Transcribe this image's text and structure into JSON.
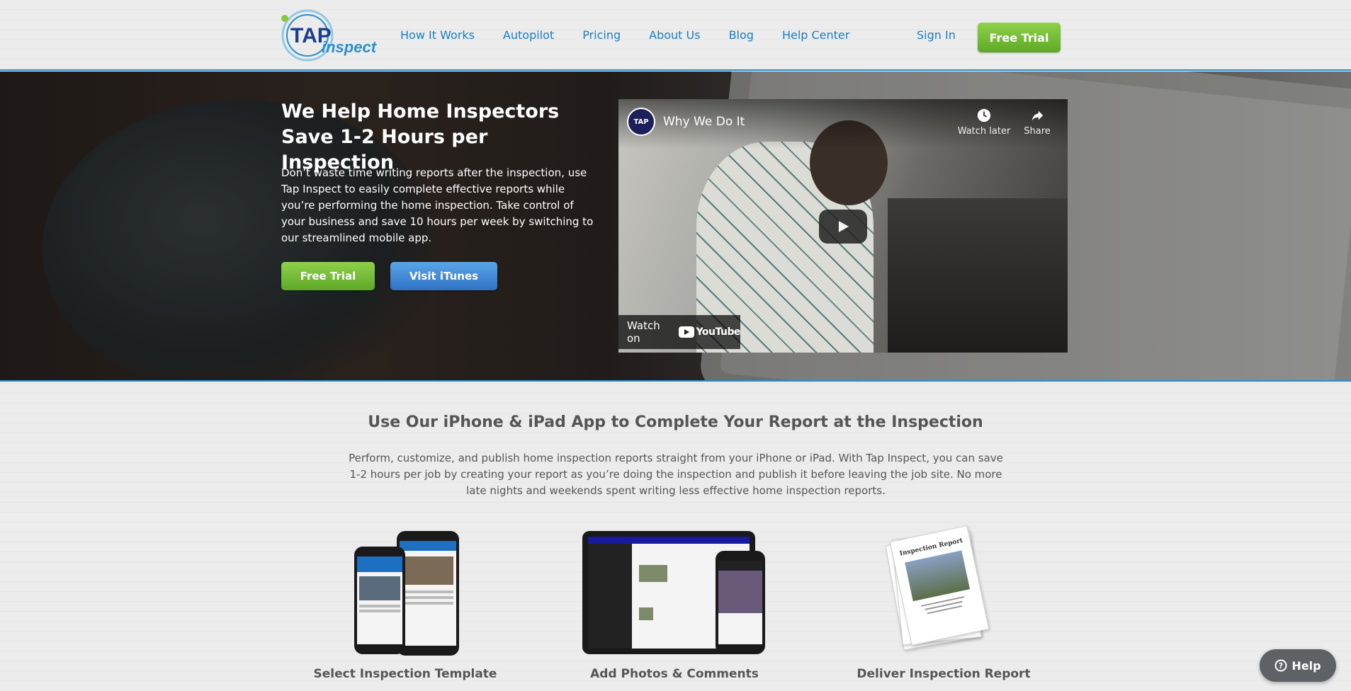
{
  "header": {
    "logo_text": "TAPinspect",
    "nav": [
      "How It Works",
      "Autopilot",
      "Pricing",
      "About Us",
      "Blog",
      "Help Center"
    ],
    "sign_in": "Sign In",
    "free_trial": "Free Trial"
  },
  "hero": {
    "title": "We Help Home Inspectors Save 1-2 Hours per Inspection",
    "text": "Don’t waste time writing reports after the inspection, use Tap Inspect to easily complete effective reports while you’re performing the home inspection. Take control of your business and save 10 hours per week by switching to our streamlined mobile app.",
    "free_trial": "Free Trial",
    "itunes": "Visit iTunes"
  },
  "video": {
    "title": "Why We Do It",
    "watch_later": "Watch later",
    "share": "Share",
    "watch_on": "Watch on",
    "youtube": "YouTube"
  },
  "section": {
    "title": "Use Our iPhone & iPad App to Complete Your Report at the Inspection",
    "text": "Perform, customize, and publish home inspection reports straight from your iPhone or iPad. With Tap Inspect, you can save 1-2 hours per job by creating your report as you’re doing the inspection and publish it before leaving the job site. No more late nights and weekends spent writing less effective home inspection reports."
  },
  "features": [
    {
      "caption": "Select Inspection Template"
    },
    {
      "caption": "Add Photos & Comments"
    },
    {
      "caption": "Deliver Inspection Report",
      "report_label": "Inspection Report"
    }
  ],
  "help": {
    "label": "Help"
  },
  "colors": {
    "accent_blue": "#1a7dc3",
    "green": "#6cb82f",
    "border_blue": "#2a8fd0"
  }
}
